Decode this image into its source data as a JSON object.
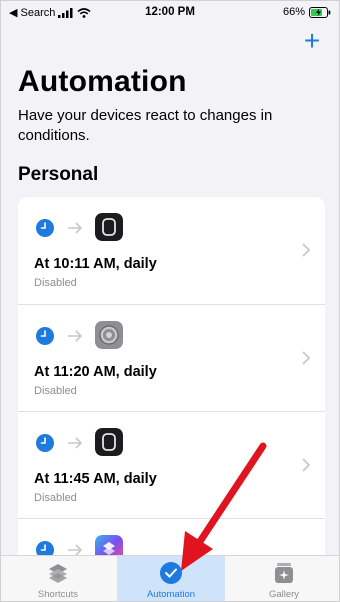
{
  "status_bar": {
    "back_label": "◀ Search",
    "time": "12:00 PM",
    "battery": "66%"
  },
  "header": {
    "add_icon": "plus-icon",
    "add_glyph": "+",
    "title": "Automation",
    "subtitle": "Have your devices react to changes in conditions."
  },
  "section": {
    "title": "Personal"
  },
  "automations": [
    {
      "title": "At 10:11 AM, daily",
      "status": "Disabled",
      "trigger_icon": "clock-icon",
      "action_icon": "watch-icon"
    },
    {
      "title": "At 11:20 AM, daily",
      "status": "Disabled",
      "trigger_icon": "clock-icon",
      "action_icon": "settings-icon"
    },
    {
      "title": "At 11:45 AM, daily",
      "status": "Disabled",
      "trigger_icon": "clock-icon",
      "action_icon": "watch-icon"
    },
    {
      "title": "",
      "status": "",
      "trigger_icon": "clock-icon",
      "action_icon": "shortcuts-icon"
    }
  ],
  "tab_bar": {
    "tabs": [
      {
        "label": "Shortcuts",
        "icon": "shortcuts-stack-icon",
        "active": false
      },
      {
        "label": "Automation",
        "icon": "automation-check-icon",
        "active": true
      },
      {
        "label": "Gallery",
        "icon": "gallery-icon",
        "active": false
      }
    ]
  },
  "colors": {
    "accent": "#1f7ae0",
    "annotation": "#e0141e",
    "active_tab_bg": "#cfe4fb"
  }
}
